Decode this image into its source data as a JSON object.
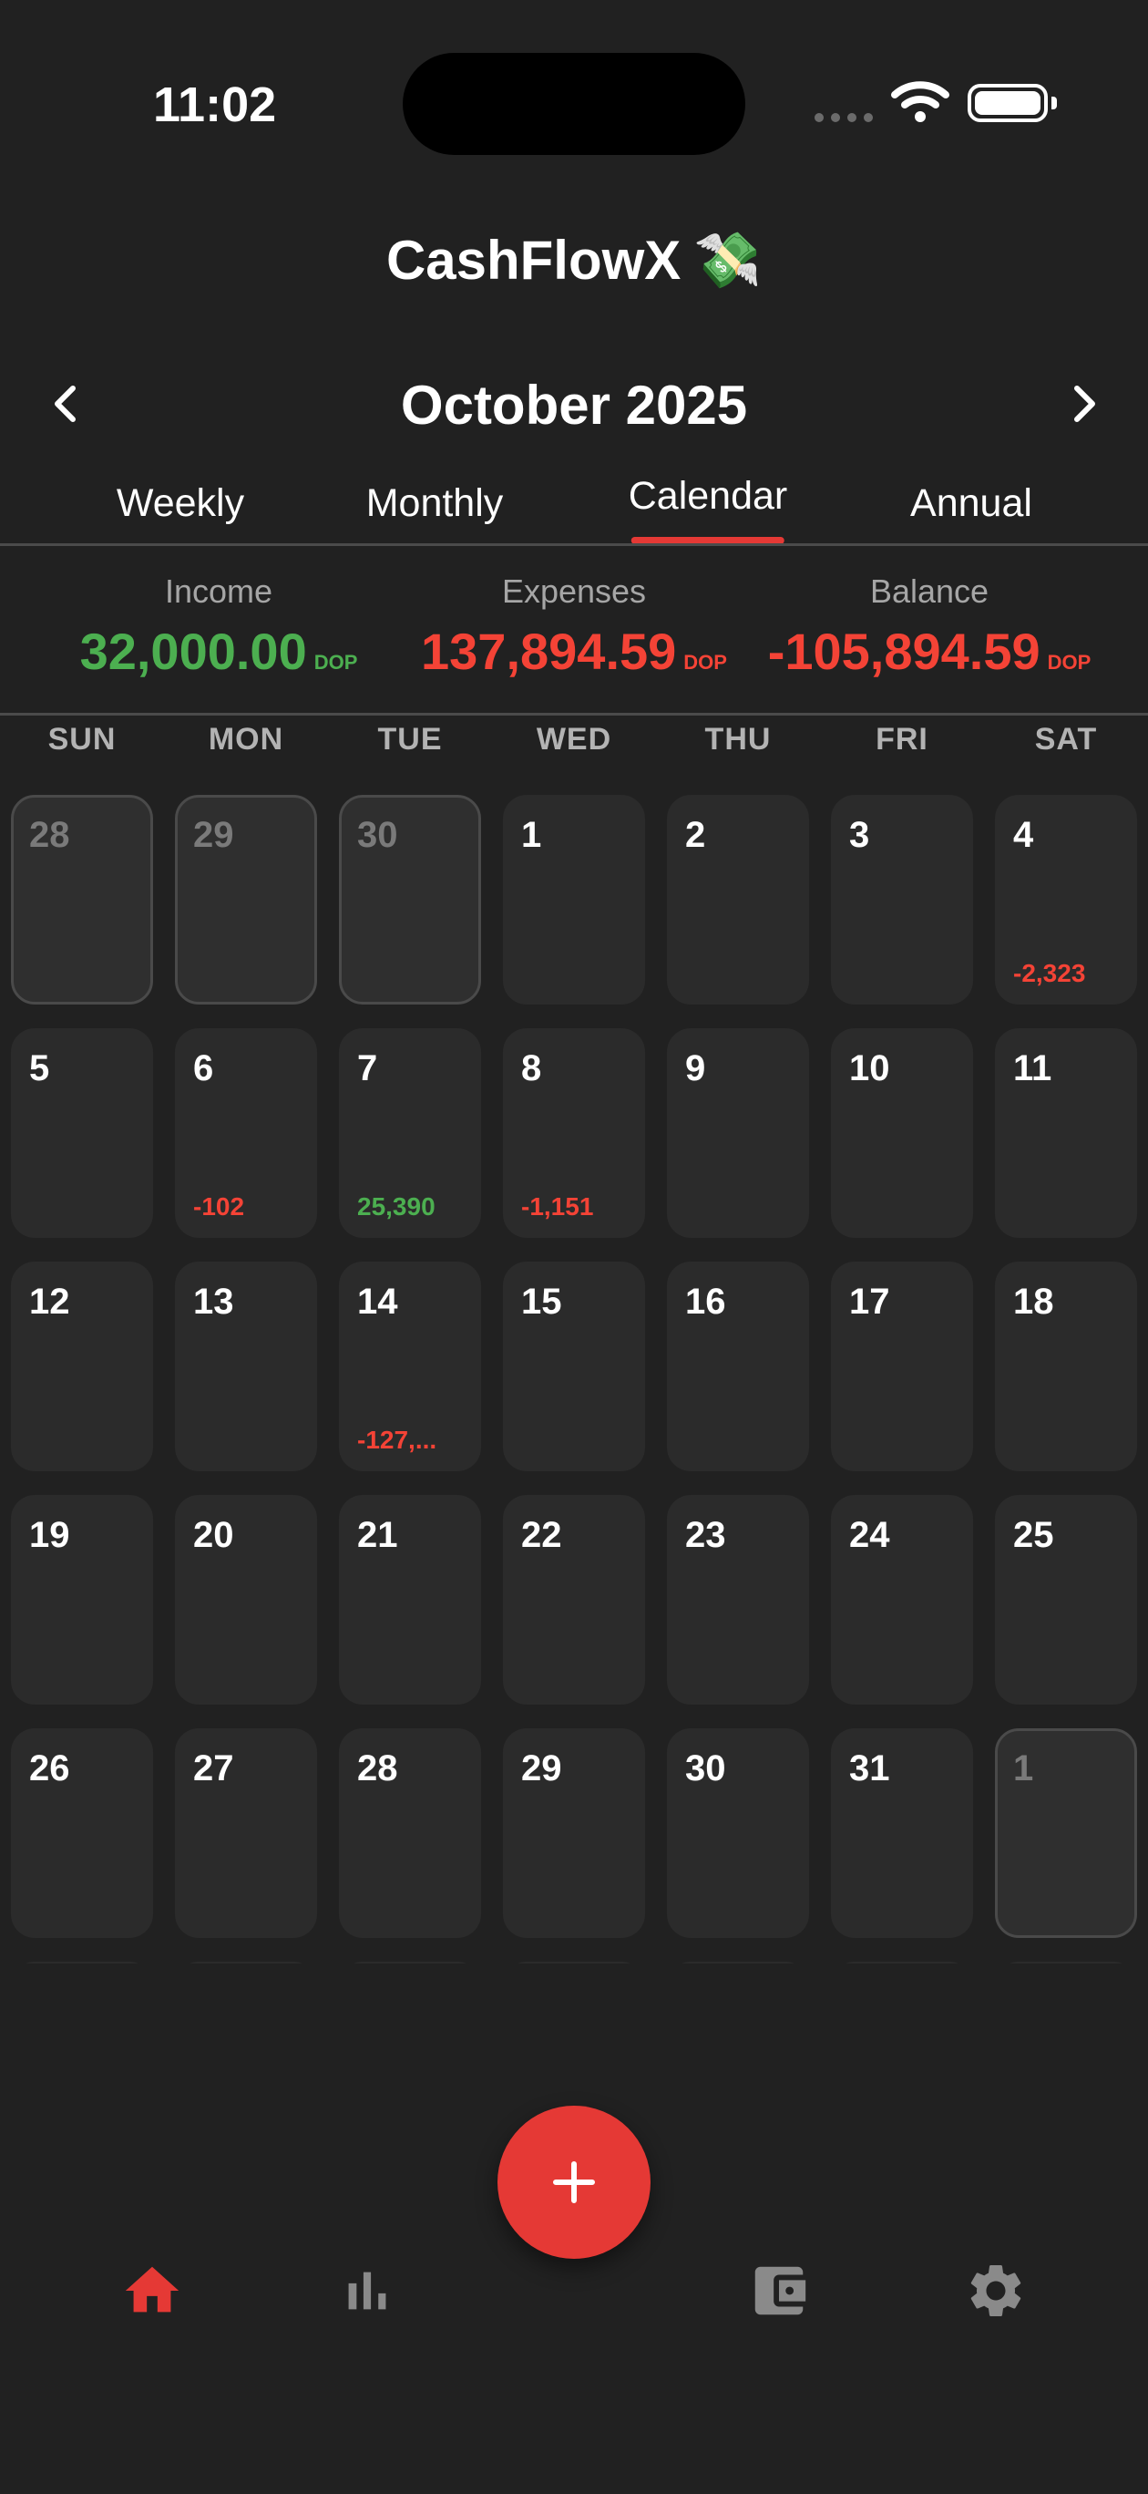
{
  "colors": {
    "background": "#212121",
    "cell": "#2b2b2b",
    "accent": "#e53935",
    "income": "#4caf50",
    "expense": "#f44336",
    "muted": "#a6a6a6",
    "icon_inactive": "#8a8a8a"
  },
  "status_bar": {
    "time": "11:02",
    "icons": [
      "signal-icon",
      "wifi-icon",
      "battery-icon"
    ]
  },
  "header": {
    "app_title": "CashFlowX",
    "app_emoji": "💸",
    "month": "October 2025",
    "prev_icon": "chevron-left-icon",
    "next_icon": "chevron-right-icon"
  },
  "tabs": [
    {
      "label": "Weekly",
      "active": false
    },
    {
      "label": "Monthly",
      "active": false
    },
    {
      "label": "Calendar",
      "active": true
    },
    {
      "label": "Annual",
      "active": false
    }
  ],
  "summary": {
    "income": {
      "label": "Income",
      "value": "32,000.00",
      "currency": "DOP"
    },
    "expenses": {
      "label": "Expenses",
      "value": "137,894.59",
      "currency": "DOP"
    },
    "balance": {
      "label": "Balance",
      "value": "-105,894.59",
      "currency": "DOP"
    }
  },
  "weekdays": [
    "SUN",
    "MON",
    "TUE",
    "WED",
    "THU",
    "FRI",
    "SAT"
  ],
  "calendar": {
    "days": [
      {
        "day": "28",
        "other": true,
        "amount": "",
        "type": ""
      },
      {
        "day": "29",
        "other": true,
        "amount": "",
        "type": ""
      },
      {
        "day": "30",
        "other": true,
        "amount": "",
        "type": ""
      },
      {
        "day": "1",
        "other": false,
        "amount": "",
        "type": ""
      },
      {
        "day": "2",
        "other": false,
        "amount": "",
        "type": ""
      },
      {
        "day": "3",
        "other": false,
        "amount": "",
        "type": ""
      },
      {
        "day": "4",
        "other": false,
        "amount": "-2,323",
        "type": "expense"
      },
      {
        "day": "5",
        "other": false,
        "amount": "",
        "type": ""
      },
      {
        "day": "6",
        "other": false,
        "amount": "-102",
        "type": "expense"
      },
      {
        "day": "7",
        "other": false,
        "amount": "25,390",
        "type": "income"
      },
      {
        "day": "8",
        "other": false,
        "amount": "-1,151",
        "type": "expense"
      },
      {
        "day": "9",
        "other": false,
        "amount": "",
        "type": ""
      },
      {
        "day": "10",
        "other": false,
        "amount": "",
        "type": ""
      },
      {
        "day": "11",
        "other": false,
        "amount": "",
        "type": ""
      },
      {
        "day": "12",
        "other": false,
        "amount": "",
        "type": ""
      },
      {
        "day": "13",
        "other": false,
        "amount": "",
        "type": ""
      },
      {
        "day": "14",
        "other": false,
        "amount": "-127,...",
        "type": "expense"
      },
      {
        "day": "15",
        "other": false,
        "amount": "",
        "type": ""
      },
      {
        "day": "16",
        "other": false,
        "amount": "",
        "type": ""
      },
      {
        "day": "17",
        "other": false,
        "amount": "",
        "type": ""
      },
      {
        "day": "18",
        "other": false,
        "amount": "",
        "type": ""
      },
      {
        "day": "19",
        "other": false,
        "amount": "",
        "type": ""
      },
      {
        "day": "20",
        "other": false,
        "amount": "",
        "type": ""
      },
      {
        "day": "21",
        "other": false,
        "amount": "",
        "type": ""
      },
      {
        "day": "22",
        "other": false,
        "amount": "",
        "type": ""
      },
      {
        "day": "23",
        "other": false,
        "amount": "",
        "type": ""
      },
      {
        "day": "24",
        "other": false,
        "amount": "",
        "type": ""
      },
      {
        "day": "25",
        "other": false,
        "amount": "",
        "type": ""
      },
      {
        "day": "26",
        "other": false,
        "amount": "",
        "type": ""
      },
      {
        "day": "27",
        "other": false,
        "amount": "",
        "type": ""
      },
      {
        "day": "28",
        "other": false,
        "amount": "",
        "type": ""
      },
      {
        "day": "29",
        "other": false,
        "amount": "",
        "type": ""
      },
      {
        "day": "30",
        "other": false,
        "amount": "",
        "type": ""
      },
      {
        "day": "31",
        "other": false,
        "amount": "",
        "type": ""
      },
      {
        "day": "1",
        "other": true,
        "amount": "",
        "type": ""
      },
      {
        "day": "",
        "other": false,
        "amount": "",
        "type": ""
      },
      {
        "day": "",
        "other": false,
        "amount": "",
        "type": ""
      },
      {
        "day": "",
        "other": false,
        "amount": "",
        "type": ""
      },
      {
        "day": "",
        "other": false,
        "amount": "",
        "type": ""
      },
      {
        "day": "",
        "other": false,
        "amount": "",
        "type": ""
      },
      {
        "day": "",
        "other": false,
        "amount": "",
        "type": ""
      },
      {
        "day": "",
        "other": false,
        "amount": "",
        "type": ""
      }
    ]
  },
  "fab": {
    "icon": "plus-icon"
  },
  "bottom_nav": [
    {
      "icon": "home-icon",
      "active": true
    },
    {
      "icon": "bar-chart-icon",
      "active": false
    },
    {
      "icon": "wallet-icon",
      "active": false
    },
    {
      "icon": "gear-icon",
      "active": false
    }
  ]
}
